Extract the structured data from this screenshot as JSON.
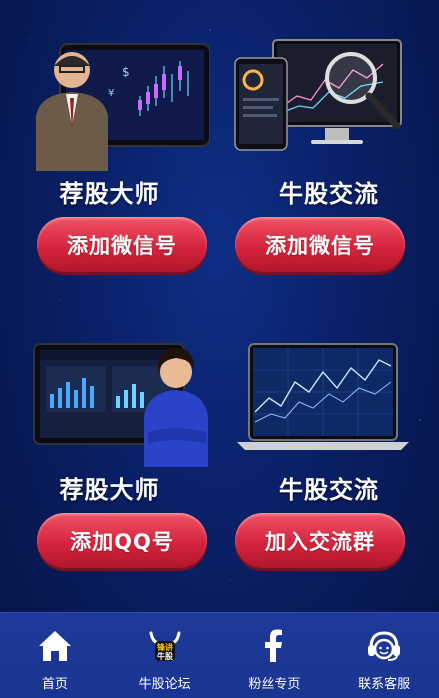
{
  "cards": [
    {
      "title": "荐股大师",
      "button": "添加微信号"
    },
    {
      "title": "牛股交流",
      "button": "添加微信号"
    },
    {
      "title": "荐股大师",
      "button": "添加QQ号"
    },
    {
      "title": "牛股交流",
      "button": "加入交流群"
    }
  ],
  "nav": {
    "items": [
      {
        "label": "首页",
        "icon": "home-icon"
      },
      {
        "label": "牛股论坛",
        "icon": "bull-logo-icon",
        "logo_text": "锋讲牛股"
      },
      {
        "label": "粉丝专页",
        "icon": "facebook-icon"
      },
      {
        "label": "联系客服",
        "icon": "headset-icon"
      }
    ]
  },
  "colors": {
    "background": "#0a1f66",
    "button": "#d5243d",
    "nav": "#1a3491"
  }
}
